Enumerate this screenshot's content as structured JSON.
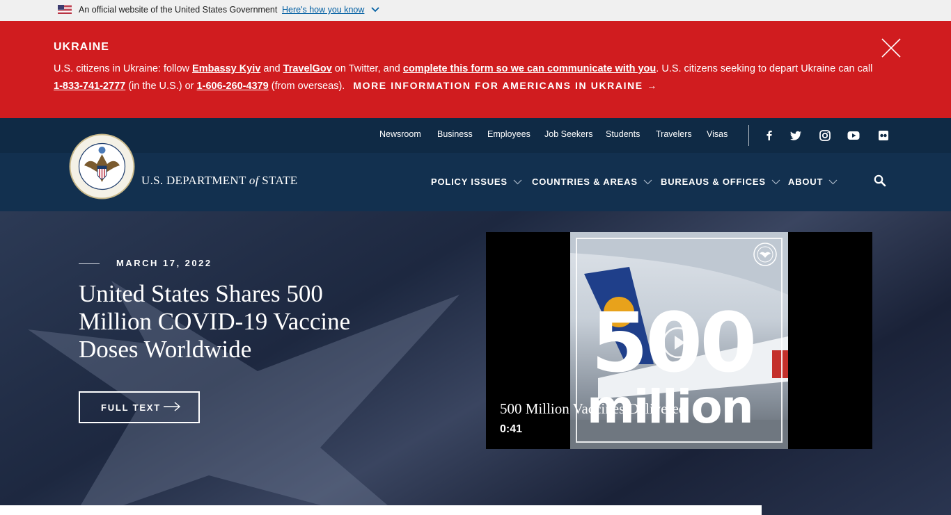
{
  "gov_banner": {
    "official_text": "An official website of the United States Government",
    "how_link": "Here's how you know"
  },
  "alert": {
    "title": "UKRAINE",
    "text_1": "U.S. citizens in Ukraine: follow ",
    "link_embassy": "Embassy Kyiv",
    "text_2": " and ",
    "link_travelgov": "TravelGov",
    "text_3": " on Twitter, and ",
    "link_form": "complete this form so we can communicate with you",
    "text_4": ". U.S. citizens seeking to depart Ukraine can call ",
    "phone_us": "1-833-741-2777",
    "text_5": " (in the U.S.) or ",
    "phone_overseas": "1-606-260-4379",
    "text_6": " (from overseas).",
    "more_info": "MORE INFORMATION FOR AMERICANS IN UKRAINE →"
  },
  "utility_nav": [
    "Newsroom",
    "Business",
    "Employees",
    "Job Seekers",
    "Students",
    "Travelers",
    "Visas"
  ],
  "social": [
    "facebook-icon",
    "twitter-icon",
    "instagram-icon",
    "youtube-icon",
    "flickr-icon"
  ],
  "agency": {
    "name_pre": "U.S. DEPARTMENT ",
    "name_of": "of",
    "name_post": " STATE",
    "seal_text_top": "DEPARTMENT OF STATE",
    "seal_text_bottom": "UNITED STATES OF AMERICA"
  },
  "main_nav": [
    "POLICY ISSUES",
    "COUNTRIES & AREAS",
    "BUREAUS & OFFICES",
    "ABOUT"
  ],
  "hero": {
    "date": "MARCH 17, 2022",
    "headline": "United States Shares 500 Million COVID-19 Vaccine Doses Worldwide",
    "button": "FULL TEXT"
  },
  "video": {
    "overlay_number": "500",
    "overlay_word": "million",
    "title": "500 Million Vaccines Delivered",
    "duration": "0:41"
  },
  "colors": {
    "alert_red": "#d01c1f",
    "header_navy": "#12304f",
    "link_blue": "#005ea2"
  }
}
